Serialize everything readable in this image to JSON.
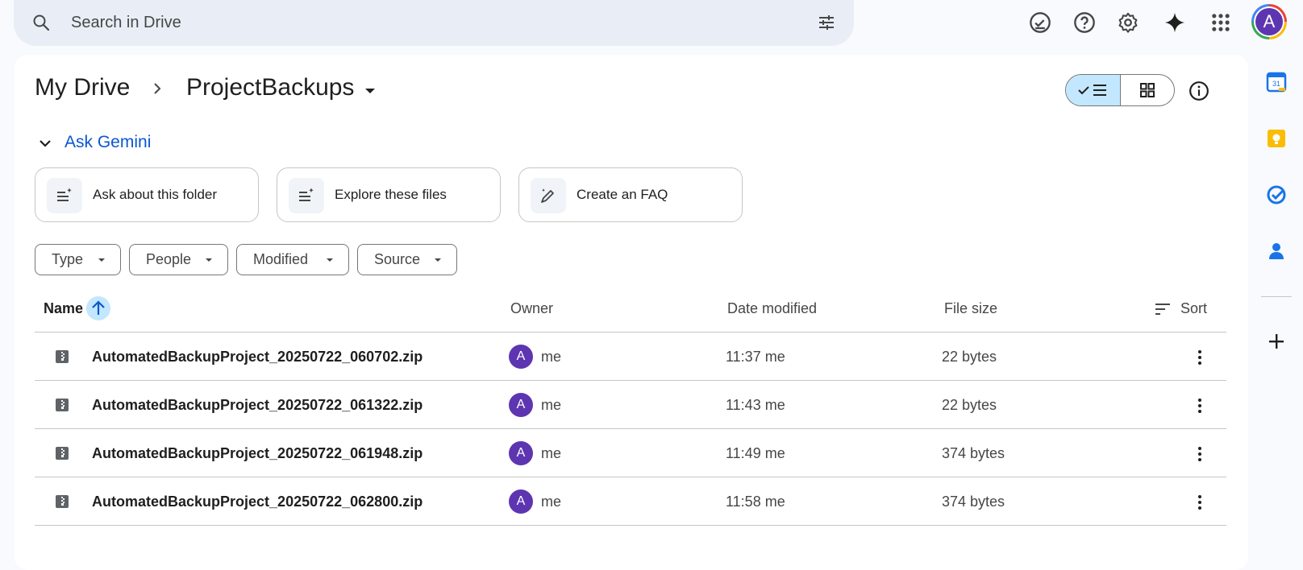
{
  "search": {
    "placeholder": "Search in Drive"
  },
  "account": {
    "initial": "A"
  },
  "breadcrumb": {
    "root": "My Drive",
    "current": "ProjectBackups"
  },
  "gemini": {
    "title": "Ask Gemini",
    "cards": [
      {
        "label": "Ask about this folder",
        "icon": "list-sparkle-icon"
      },
      {
        "label": "Explore these files",
        "icon": "list-sparkle-icon"
      },
      {
        "label": "Create an FAQ",
        "icon": "pen-sparkle-icon"
      }
    ]
  },
  "filters": [
    "Type",
    "People",
    "Modified",
    "Source"
  ],
  "table": {
    "headers": {
      "name": "Name",
      "owner": "Owner",
      "date": "Date modified",
      "size": "File size",
      "sort": "Sort"
    },
    "rows": [
      {
        "name": "AutomatedBackupProject_20250722_060702.zip",
        "owner_initial": "A",
        "owner": "me",
        "date": "11:37 me",
        "size": "22 bytes"
      },
      {
        "name": "AutomatedBackupProject_20250722_061322.zip",
        "owner_initial": "A",
        "owner": "me",
        "date": "11:43 me",
        "size": "22 bytes"
      },
      {
        "name": "AutomatedBackupProject_20250722_061948.zip",
        "owner_initial": "A",
        "owner": "me",
        "date": "11:49 me",
        "size": "374 bytes"
      },
      {
        "name": "AutomatedBackupProject_20250722_062800.zip",
        "owner_initial": "A",
        "owner": "me",
        "date": "11:58 me",
        "size": "374 bytes"
      }
    ]
  },
  "sidebar": {
    "calendar_day": "31"
  },
  "colors": {
    "accent": "#0b57d0",
    "selected": "#c2e7ff",
    "avatar": "#5e35b1"
  }
}
